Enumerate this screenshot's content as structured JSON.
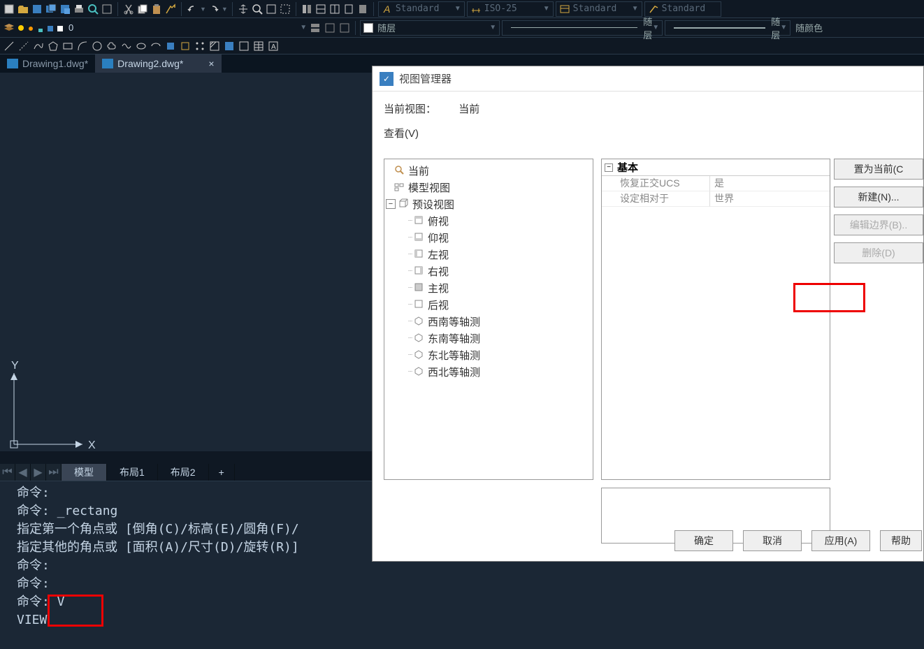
{
  "styles": {
    "text": "Standard",
    "dim": "ISO-25",
    "table": "Standard",
    "multi": "Standard"
  },
  "layer": {
    "current": "随层",
    "linetype": "随层",
    "lineweight": "随层",
    "color": "随颜色"
  },
  "layerNum": "0",
  "tabs": {
    "t1": "Drawing1.dwg*",
    "t2": "Drawing2.dwg*"
  },
  "axes": {
    "x": "X",
    "y": "Y"
  },
  "layoutTabs": {
    "model": "模型",
    "l1": "布局1",
    "l2": "布局2",
    "plus": "+"
  },
  "cmd": {
    "l1": "命令:",
    "l2": "命令: _rectang",
    "l3": "指定第一个角点或 [倒角(C)/标高(E)/圆角(F)/",
    "l4": "指定其他的角点或 [面积(A)/尺寸(D)/旋转(R)]",
    "l5": "命令:",
    "l6": "命令:",
    "l7": "命令: V",
    "l8": "VIEW"
  },
  "dialog": {
    "title": "视图管理器",
    "curViewLabel": "当前视图：",
    "curViewVal": "当前",
    "viewLabel": "查看(V)",
    "tree": {
      "current": "当前",
      "modelViews": "模型视图",
      "presetViews": "预设视图",
      "top": "俯视",
      "bottom": "仰视",
      "left": "左视",
      "right": "右视",
      "front": "主视",
      "back": "后视",
      "swIso": "西南等轴测",
      "seIso": "东南等轴测",
      "neIso": "东北等轴测",
      "nwIso": "西北等轴测"
    },
    "props": {
      "groupBasic": "基本",
      "restoreUcs": "恢复正交UCS",
      "restoreUcsVal": "是",
      "relativeTo": "设定相对于",
      "relativeToVal": "世界"
    },
    "buttons": {
      "setCurrent": "置为当前(C",
      "new": "新建(N)...",
      "editBounds": "编辑边界(B)..",
      "delete": "删除(D)",
      "ok": "确定",
      "cancel": "取消",
      "apply": "应用(A)",
      "help": "帮助"
    }
  }
}
